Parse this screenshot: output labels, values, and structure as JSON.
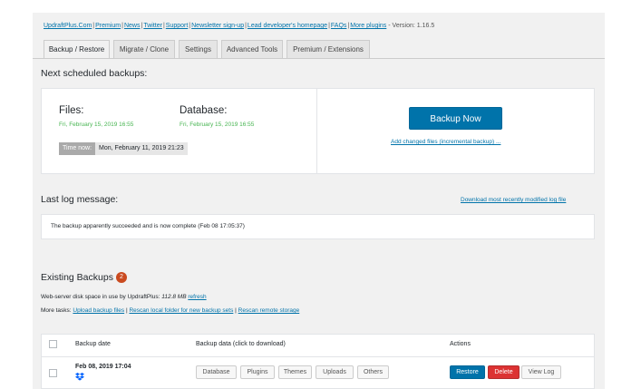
{
  "top_links": {
    "items": [
      "UpdraftPlus.Com",
      "Premium",
      "News",
      "Twitter",
      "Support",
      "Newsletter sign-up",
      "Lead developer's homepage",
      "FAQs",
      "More plugins"
    ],
    "version": "- Version: 1.16.5"
  },
  "tabs": [
    "Backup / Restore",
    "Migrate / Clone",
    "Settings",
    "Advanced Tools",
    "Premium / Extensions"
  ],
  "next_backups": {
    "heading": "Next scheduled backups:",
    "files_label": "Files:",
    "files_date": "Fri, February 15, 2019 16:55",
    "db_label": "Database:",
    "db_date": "Fri, February 15, 2019 16:55",
    "time_now_label": "Time now:",
    "time_now_value": "Mon, February 11, 2019 21:23",
    "backup_now_label": "Backup Now",
    "incremental_link": "Add changed files (incremental backup) ..."
  },
  "log": {
    "heading": "Last log message:",
    "download_link": "Download most recently modified log file",
    "message": "The backup apparently succeeded and is now complete (Feb 08 17:05:37)"
  },
  "existing": {
    "heading": "Existing Backups",
    "count": "2",
    "disk_prefix": "Web-server disk space in use by UpdraftPlus:",
    "disk_value": "112.8 MB",
    "refresh": "refresh",
    "more_tasks": "More tasks:",
    "task_upload": "Upload backup files",
    "task_rescan_local": "Rescan local folder for new backup sets",
    "task_rescan_remote": "Rescan remote storage",
    "col_date": "Backup date",
    "col_data": "Backup data (click to download)",
    "col_actions": "Actions",
    "row": {
      "date": "Feb 08, 2019 17:04",
      "data_buttons": [
        "Database",
        "Plugins",
        "Themes",
        "Uploads",
        "Others"
      ],
      "restore": "Restore",
      "delete": "Delete",
      "view_log": "View Log"
    }
  },
  "colors": {
    "accent": "#0073aa",
    "green": "#46b450",
    "danger": "#dc3232",
    "badge": "#ca4a1f",
    "dropbox": "#0061fe"
  },
  "icons": {
    "storage": "dropbox-icon"
  }
}
